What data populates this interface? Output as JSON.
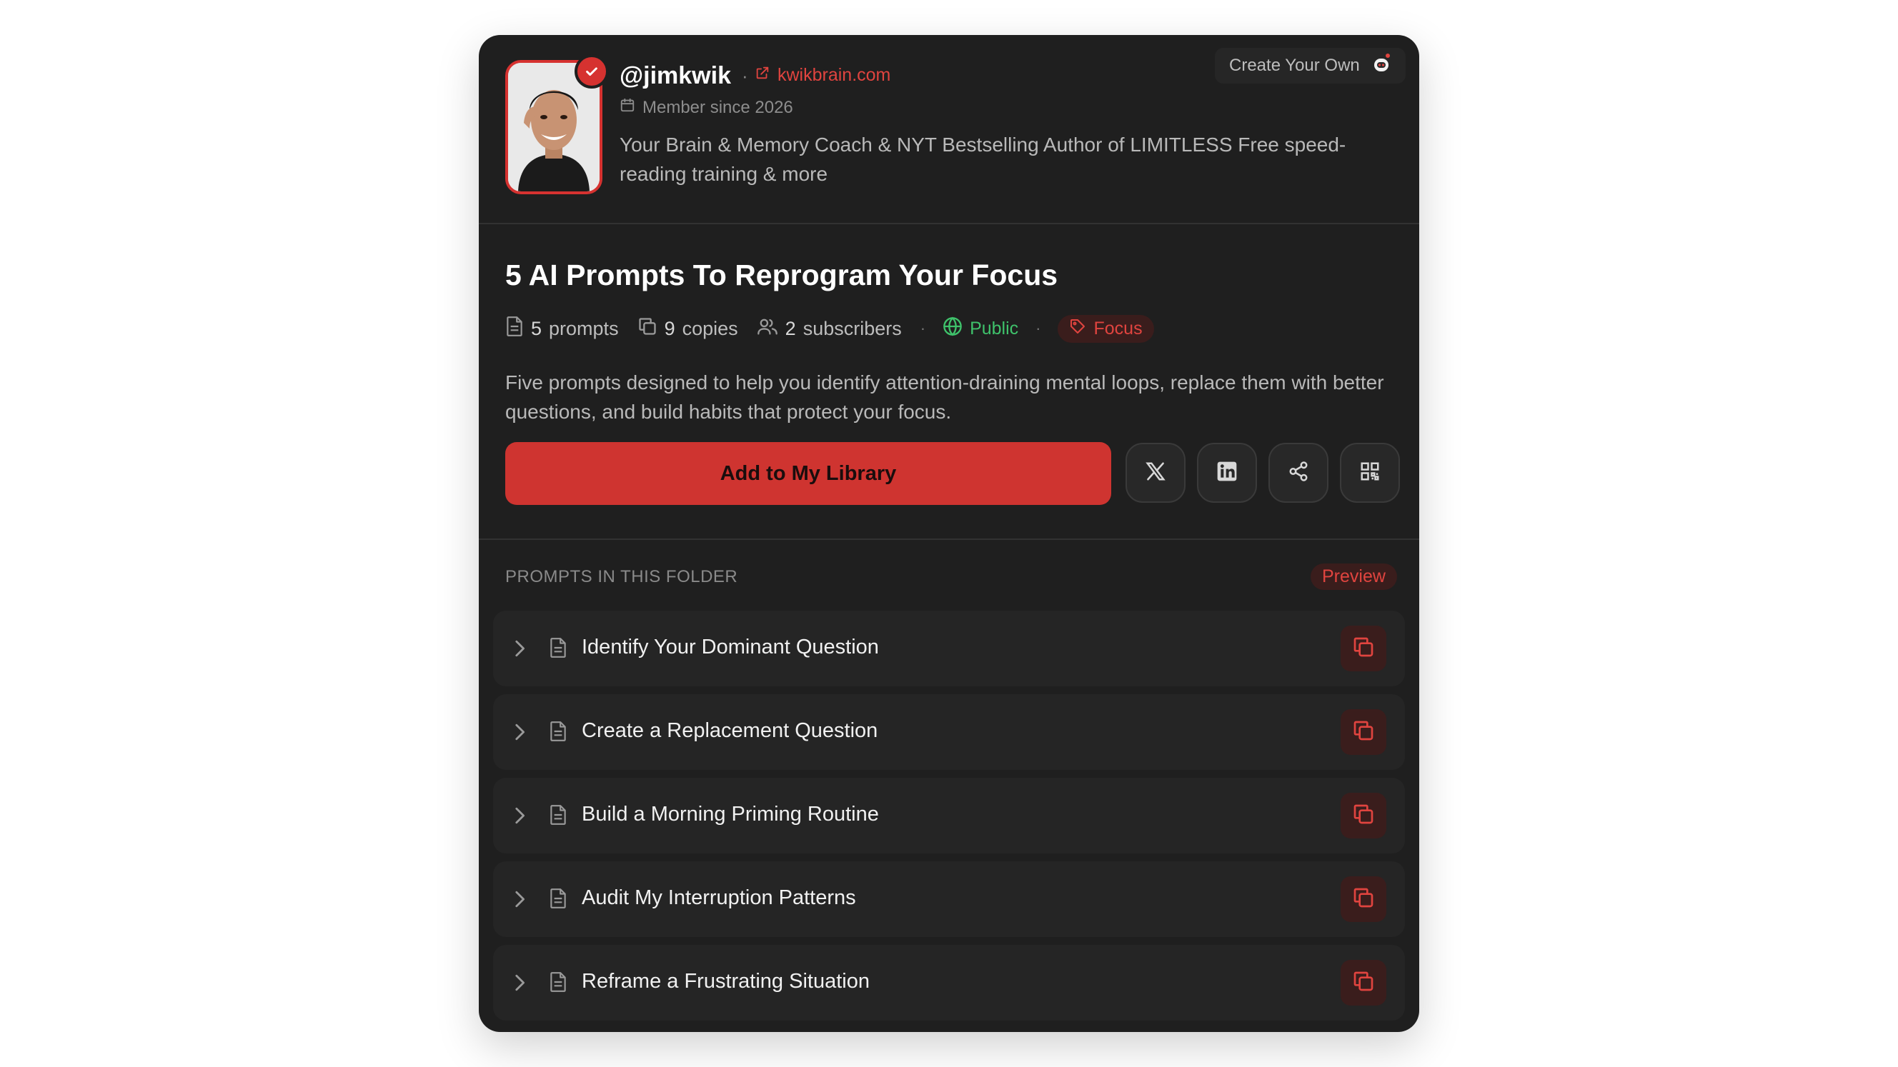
{
  "profile": {
    "handle": "@jimkwik",
    "website": "kwikbrain.com",
    "member_since": "Member since 2026",
    "bio": "Your Brain & Memory Coach & NYT Bestselling Author of LIMITLESS Free speed-reading training & more",
    "create_own_label": "Create Your Own"
  },
  "folder": {
    "title": "5 AI Prompts To Reprogram Your Focus",
    "prompts_count": "5",
    "prompts_label": "prompts",
    "copies_count": "9",
    "copies_label": "copies",
    "subscribers_count": "2",
    "subscribers_label": "subscribers",
    "visibility": "Public",
    "tag": "Focus",
    "description": "Five prompts designed to help you identify attention-draining mental loops, replace them with better questions, and build habits that protect your focus.",
    "add_button_label": "Add to My Library"
  },
  "prompts_section": {
    "label": "PROMPTS IN THIS FOLDER",
    "preview_label": "Preview",
    "items": [
      {
        "label": "Identify Your Dominant Question"
      },
      {
        "label": "Create a Replacement Question"
      },
      {
        "label": "Build a Morning Priming Routine"
      },
      {
        "label": "Audit My Interruption Patterns"
      },
      {
        "label": "Reframe a Frustrating Situation"
      }
    ]
  },
  "colors": {
    "accent": "#cf3430",
    "card_bg": "#1f1f1f",
    "public_green": "#3fc26b"
  },
  "icons": [
    "verified-check-icon",
    "external-link-icon",
    "calendar-icon",
    "robot-icon",
    "document-icon",
    "copy-icon",
    "users-icon",
    "globe-icon",
    "tag-icon",
    "x-logo-icon",
    "linkedin-icon",
    "share-icon",
    "qr-code-icon",
    "chevron-right-icon"
  ]
}
